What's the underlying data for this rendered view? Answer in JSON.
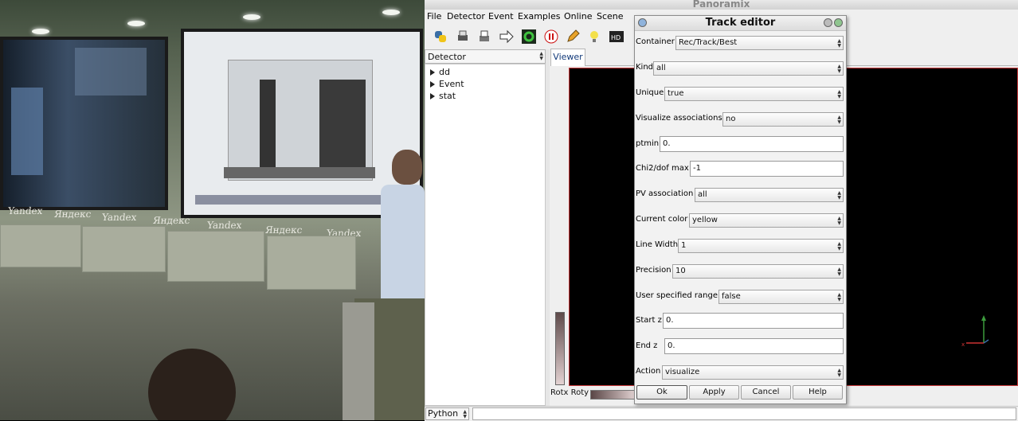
{
  "app": {
    "window_title": "Panoramix",
    "menu": [
      "File",
      "Detector",
      "Event",
      "Examples",
      "Online",
      "Scene"
    ],
    "tree_header": "Detector",
    "tree_items": [
      "dd",
      "Event",
      "stat"
    ],
    "viewer_tab": "Viewer",
    "rot_label": "Rotx Roty",
    "python_combo": "Python",
    "toolbar_icons": [
      "python-icon",
      "print-icon",
      "print-alt-icon",
      "arrow-right-icon",
      "refresh-icon",
      "stop-icon",
      "pencil-icon",
      "bulb-icon",
      "hd-icon"
    ]
  },
  "dialog": {
    "title": "Track editor",
    "fields": {
      "container": {
        "label": "Container",
        "value": "Rec/Track/Best"
      },
      "kind": {
        "label": "Kind",
        "value": "all"
      },
      "unique": {
        "label": "Unique",
        "value": "true"
      },
      "vis_assoc": {
        "label": "Visualize associations",
        "value": "no"
      },
      "ptmin": {
        "label": "ptmin",
        "value": "0."
      },
      "chi2": {
        "label": "Chi2/dof max",
        "value": "-1"
      },
      "pv_assoc": {
        "label": "PV association",
        "value": "all"
      },
      "color": {
        "label": "Current color",
        "value": "yellow"
      },
      "line_width": {
        "label": "Line Width",
        "value": "1"
      },
      "precision": {
        "label": "Precision",
        "value": "10"
      },
      "user_range": {
        "label": "User specified range",
        "value": "false"
      },
      "start_z": {
        "label": "Start z",
        "value": "0."
      },
      "end_z": {
        "label": "End z",
        "value": "0."
      },
      "action": {
        "label": "Action",
        "value": "visualize"
      }
    },
    "buttons": {
      "ok": "Ok",
      "apply": "Apply",
      "cancel": "Cancel",
      "help": "Help"
    }
  },
  "video": {
    "banner": [
      "Yandex",
      "Яндекс",
      "Yandex",
      "Яндекс",
      "Yandex",
      "Яндекс",
      "Yandex"
    ]
  }
}
